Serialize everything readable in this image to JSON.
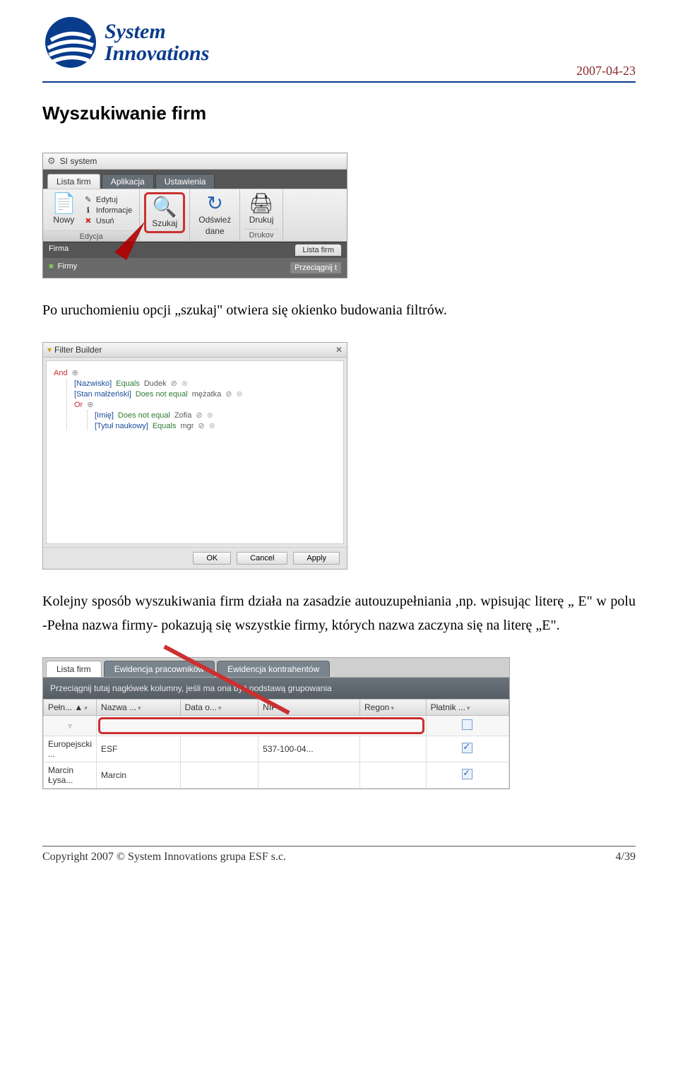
{
  "header": {
    "logo_line1": "System",
    "logo_line2": "Innovations",
    "date": "2007-04-23"
  },
  "section_title": "Wyszukiwanie firm",
  "screenshot1": {
    "window_title": "SI system",
    "tabs": {
      "active": "Lista firm",
      "t2": "Aplikacja",
      "t3": "Ustawienia"
    },
    "ribbon": {
      "nowy": "Nowy",
      "edytuj": "Edytuj",
      "informacje": "Informacje",
      "usun": "Usuń",
      "szukaj": "Szukaj",
      "odswiez_l1": "Odśwież",
      "odswiez_l2": "dane",
      "drukuj": "Drukuj",
      "group_edycja": "Edycja",
      "group_drukow": "Drukov"
    },
    "leftbar": {
      "firma": "Firma",
      "firmy": "Firmy"
    },
    "rightblock": {
      "lista_firm": "Lista firm",
      "drag": "Przeciągnij t"
    }
  },
  "para1": "Po uruchomieniu opcji „szukaj\" otwiera się okienko budowania filtrów.",
  "screenshot2": {
    "title": "Filter Builder",
    "root": "And",
    "rule1_field": "[Nazwisko]",
    "rule1_op": "Equals",
    "rule1_val": "Dudek",
    "rule2_field": "[Stan małżeński]",
    "rule2_op": "Does not equal",
    "rule2_val": "mężatka",
    "or_label": "Or",
    "rule3_field": "[Imię]",
    "rule3_op": "Does not equal",
    "rule3_val": "Zofia",
    "rule4_field": "[Tytuł naukowy]",
    "rule4_op": "Equals",
    "rule4_val": "mgr",
    "btn_ok": "OK",
    "btn_cancel": "Cancel",
    "btn_apply": "Apply"
  },
  "para2": "Kolejny sposób wyszukiwania firm działa na zasadzie autouzupełniania ,np. wpisując literę „ E\" w polu -Pełna nazwa firmy- pokazują się wszystkie firmy, których nazwa zaczyna się na literę „E\".",
  "screenshot3": {
    "tabs": {
      "active": "Lista firm",
      "t2": "Ewidencja pracowników",
      "t3": "Ewidencja kontrahentów"
    },
    "groupbar": "Przeciągnij tutaj nagłówek kolumny, jeśli ma ona być podstawą grupowania",
    "cols": {
      "c1": "Pełn... ▲",
      "c2": "Nazwa ...",
      "c3": "Data o...",
      "c4": "NIP",
      "c5": "Regon",
      "c6": "Płatnik ..."
    },
    "row1": {
      "c1": "Europejscki ...",
      "c2": "ESF",
      "c3": "",
      "c4": "537-100-04...",
      "c5": "",
      "c6_checked": true
    },
    "row2": {
      "c1": "Marcin Łysa...",
      "c2": "Marcin",
      "c3": "",
      "c4": "",
      "c5": "",
      "c6_checked": true
    }
  },
  "footer": {
    "left": "Copyright 2007 © System Innovations grupa ESF s.c.",
    "right": "4/39"
  }
}
